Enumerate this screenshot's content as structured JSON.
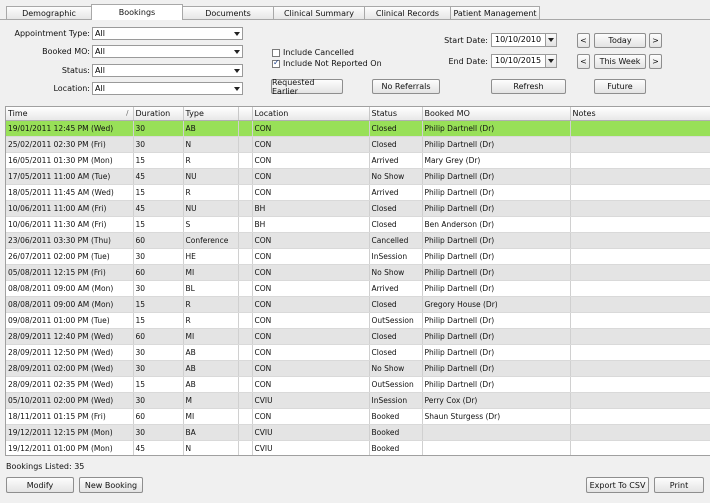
{
  "tabs": [
    {
      "label": "Demographic",
      "active": false
    },
    {
      "label": "Bookings",
      "active": true
    },
    {
      "label": "Documents",
      "active": false
    },
    {
      "label": "Clinical Summary",
      "active": false
    },
    {
      "label": "Clinical Records",
      "active": false
    },
    {
      "label": "Patient Management",
      "active": false
    }
  ],
  "filters": {
    "appointment_type": {
      "label": "Appointment Type:",
      "value": "All"
    },
    "booked_mo": {
      "label": "Booked MO:",
      "value": "All"
    },
    "status": {
      "label": "Status:",
      "value": "All"
    },
    "location": {
      "label": "Location:",
      "value": "All"
    },
    "include_cancelled": {
      "label": "Include Cancelled",
      "checked": false
    },
    "include_not_reported": {
      "label": "Include Not Reported On",
      "checked": true
    },
    "start_date": {
      "label": "Start Date:",
      "value": "10/10/2010"
    },
    "end_date": {
      "label": "End Date:",
      "value": "10/10/2015"
    }
  },
  "buttons": {
    "requested_earlier": "Requested Earlier",
    "no_referrals": "No Referrals",
    "refresh": "Refresh",
    "prev": "<",
    "next": ">",
    "today": "Today",
    "this_week": "This Week",
    "future": "Future",
    "modify": "Modify",
    "new_booking": "New Booking",
    "export_csv": "Export To CSV",
    "print": "Print"
  },
  "grid": {
    "columns": [
      "Time",
      "Duration",
      "Type",
      "",
      "Location",
      "Status",
      "Booked MO",
      "Notes"
    ],
    "sort_indicator": "/",
    "rows": [
      [
        "19/01/2011 12:45 PM (Wed)",
        "30",
        "AB",
        "",
        "CON",
        "Closed",
        "Philip Dartnell (Dr)",
        ""
      ],
      [
        "25/02/2011 02:30 PM (Fri)",
        "30",
        "N",
        "",
        "CON",
        "Closed",
        "Philip Dartnell (Dr)",
        ""
      ],
      [
        "16/05/2011 01:30 PM (Mon)",
        "15",
        "R",
        "",
        "CON",
        "Arrived",
        "Mary Grey (Dr)",
        ""
      ],
      [
        "17/05/2011 11:00 AM (Tue)",
        "45",
        "NU",
        "",
        "CON",
        "No Show",
        "Philip Dartnell (Dr)",
        ""
      ],
      [
        "18/05/2011 11:45 AM (Wed)",
        "15",
        "R",
        "",
        "CON",
        "Arrived",
        "Philip Dartnell (Dr)",
        ""
      ],
      [
        "10/06/2011 11:00 AM (Fri)",
        "45",
        "NU",
        "",
        "BH",
        "Closed",
        "Philip Dartnell (Dr)",
        ""
      ],
      [
        "10/06/2011 11:30 AM (Fri)",
        "15",
        "S",
        "",
        "BH",
        "Closed",
        "Ben Anderson (Dr)",
        ""
      ],
      [
        "23/06/2011 03:30 PM (Thu)",
        "60",
        "Conference",
        "",
        "CON",
        "Cancelled",
        "Philip Dartnell (Dr)",
        ""
      ],
      [
        "26/07/2011 02:00 PM (Tue)",
        "30",
        "HE",
        "",
        "CON",
        "InSession",
        "Philip Dartnell (Dr)",
        ""
      ],
      [
        "05/08/2011 12:15 PM (Fri)",
        "60",
        "MI",
        "",
        "CON",
        "No Show",
        "Philip Dartnell (Dr)",
        ""
      ],
      [
        "08/08/2011 09:00 AM (Mon)",
        "30",
        "BL",
        "",
        "CON",
        "Arrived",
        "Philip Dartnell (Dr)",
        ""
      ],
      [
        "08/08/2011 09:00 AM (Mon)",
        "15",
        "R",
        "",
        "CON",
        "Closed",
        "Gregory House (Dr)",
        ""
      ],
      [
        "09/08/2011 01:00 PM (Tue)",
        "15",
        "R",
        "",
        "CON",
        "OutSession",
        "Philip Dartnell (Dr)",
        ""
      ],
      [
        "28/09/2011 12:40 PM (Wed)",
        "60",
        "MI",
        "",
        "CON",
        "Closed",
        "Philip Dartnell (Dr)",
        ""
      ],
      [
        "28/09/2011 12:50 PM (Wed)",
        "30",
        "AB",
        "",
        "CON",
        "Closed",
        "Philip Dartnell (Dr)",
        ""
      ],
      [
        "28/09/2011 02:00 PM (Wed)",
        "30",
        "AB",
        "",
        "CON",
        "No Show",
        "Philip Dartnell (Dr)",
        ""
      ],
      [
        "28/09/2011 02:35 PM (Wed)",
        "15",
        "AB",
        "",
        "CON",
        "OutSession",
        "Philip Dartnell (Dr)",
        ""
      ],
      [
        "05/10/2011 02:00 PM (Wed)",
        "30",
        "M",
        "",
        "CVIU",
        "InSession",
        "Perry Cox (Dr)",
        ""
      ],
      [
        "18/11/2011 01:15 PM (Fri)",
        "60",
        "MI",
        "",
        "CON",
        "Booked",
        "Shaun Sturgess (Dr)",
        ""
      ],
      [
        "19/12/2011 12:15 PM (Mon)",
        "30",
        "BA",
        "",
        "CVIU",
        "Booked",
        "",
        ""
      ],
      [
        "19/12/2011 01:00 PM (Mon)",
        "45",
        "N",
        "",
        "CVIU",
        "Booked",
        "",
        ""
      ]
    ]
  },
  "status_bar": "Bookings Listed: 35"
}
